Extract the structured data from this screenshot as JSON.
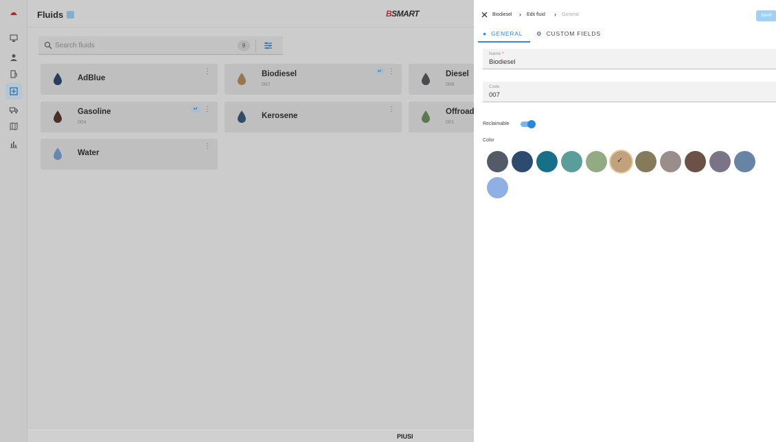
{
  "app": {
    "page_title": "Fluids",
    "brand_prefix": "B",
    "brand_text": "SMART",
    "footer_logo": "PIUSI"
  },
  "rail": {
    "items": [
      "logo-icon",
      "monitor-icon",
      "user-icon",
      "fuel-pump-icon",
      "fluid-icon",
      "truck-icon",
      "map-icon",
      "chart-icon"
    ],
    "active": "fluid-icon"
  },
  "search": {
    "placeholder": "Search fluids",
    "count": "9"
  },
  "fluids": [
    {
      "name": "AdBlue",
      "code": "",
      "color": "#2f4a70",
      "tag": false
    },
    {
      "name": "Biodiesel",
      "code": "007",
      "color": "#b88d60",
      "tag": true
    },
    {
      "name": "Diesel",
      "code": "008",
      "color": "#555b60",
      "tag": false
    },
    {
      "name": "Gasoline",
      "code": "004",
      "color": "#5a3b2d",
      "tag": true
    },
    {
      "name": "Kerosene",
      "code": "",
      "color": "#3e5a78",
      "tag": false
    },
    {
      "name": "Offroad",
      "code": "001",
      "color": "#6f8f5f",
      "tag": false
    },
    {
      "name": "Water",
      "code": "",
      "color": "#7aa2d6",
      "tag": false
    }
  ],
  "drawer": {
    "breadcrumb": [
      "Biodiesel",
      "Edit fluid",
      "General"
    ],
    "save_label": "Save",
    "tabs": [
      "GENERAL",
      "CUSTOM FIELDS"
    ],
    "active_tab": "GENERAL",
    "name_label": "Name",
    "name_required_mark": "*",
    "name_value": "Biodiesel",
    "code_label": "Code",
    "code_value": "007",
    "reclaimable_label": "Reclaimable",
    "reclaimable_on": true,
    "color_label": "Color",
    "check_glyph": "✓",
    "colors": [
      "#535a68",
      "#2e4a6e",
      "#177088",
      "#5b9d9b",
      "#93ab83",
      "#c2a27c",
      "#857a5b",
      "#9a8e8b",
      "#6c5147",
      "#7b7386",
      "#6784a4",
      "#8fb0e3"
    ],
    "selected_color": "#c2a27c"
  },
  "accent": "#2b87d6"
}
